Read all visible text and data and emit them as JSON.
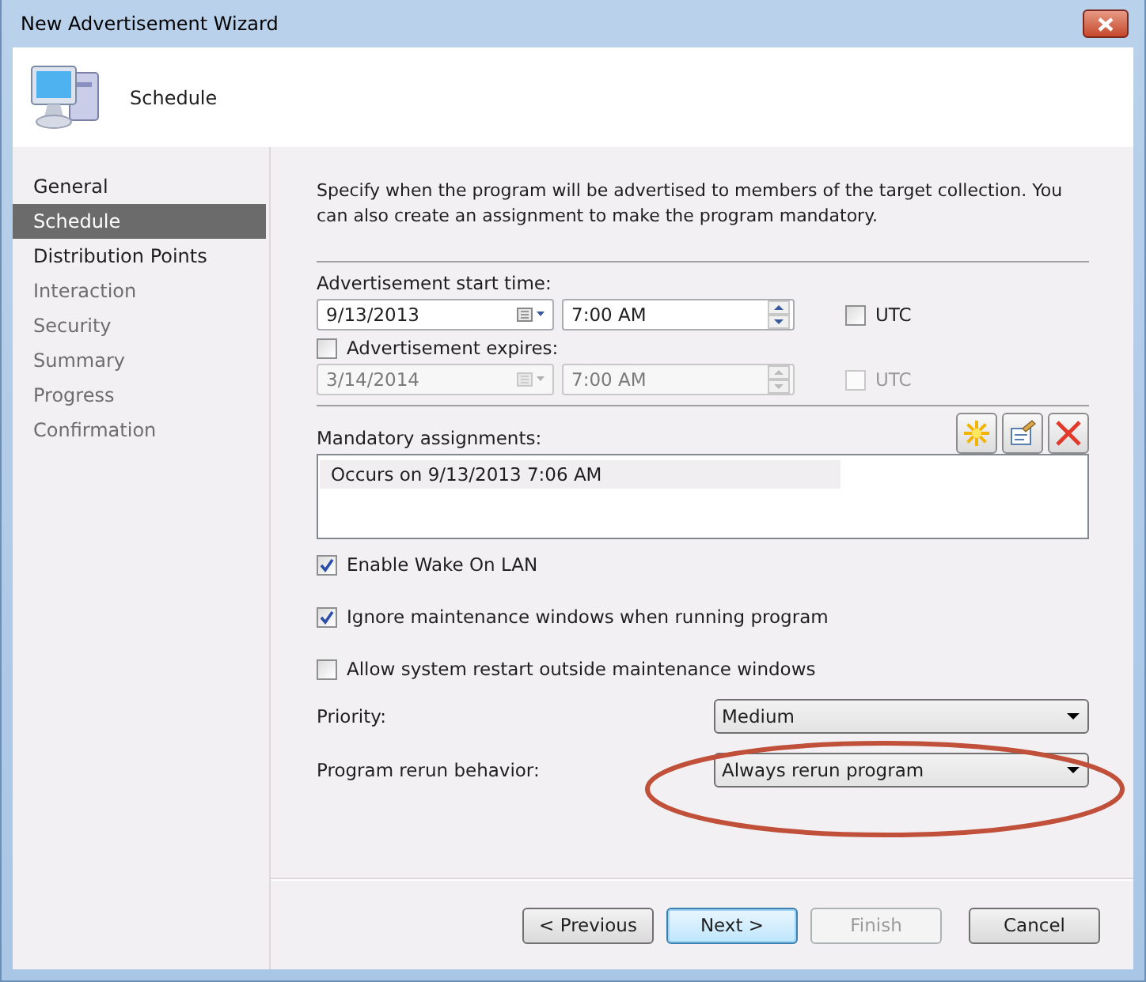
{
  "window": {
    "title": "New Advertisement Wizard"
  },
  "header": {
    "title": "Schedule"
  },
  "steps": [
    {
      "label": "General",
      "selected": false,
      "disabled": false
    },
    {
      "label": "Schedule",
      "selected": true,
      "disabled": false
    },
    {
      "label": "Distribution Points",
      "selected": false,
      "disabled": false
    },
    {
      "label": "Interaction",
      "selected": false,
      "disabled": true
    },
    {
      "label": "Security",
      "selected": false,
      "disabled": true
    },
    {
      "label": "Summary",
      "selected": false,
      "disabled": true
    },
    {
      "label": "Progress",
      "selected": false,
      "disabled": true
    },
    {
      "label": "Confirmation",
      "selected": false,
      "disabled": true
    }
  ],
  "description": "Specify when the program will be advertised to members of the target collection. You can also create an assignment to make the program mandatory.",
  "start": {
    "label": "Advertisement start time:",
    "date": "9/13/2013",
    "time": "7:00 AM",
    "utc_label": "UTC",
    "utc_checked": false,
    "disabled": false
  },
  "expires": {
    "label": "Advertisement expires:",
    "checked": false,
    "date": "3/14/2014",
    "time": "7:00 AM",
    "utc_label": "UTC",
    "utc_checked": false,
    "disabled": true
  },
  "assignments": {
    "label": "Mandatory assignments:",
    "items": [
      "Occurs on 9/13/2013 7:06 AM"
    ]
  },
  "options": [
    {
      "label": "Enable Wake On LAN",
      "checked": true
    },
    {
      "label": "Ignore maintenance windows when running program",
      "checked": true
    },
    {
      "label": "Allow system restart outside maintenance windows",
      "checked": false
    }
  ],
  "selects": [
    {
      "label": "Priority:",
      "value": "Medium",
      "highlighted": false
    },
    {
      "label": "Program rerun behavior:",
      "value": "Always rerun program",
      "highlighted": true
    }
  ],
  "buttons": [
    {
      "label": "< Previous",
      "disabled": false,
      "default": false
    },
    {
      "label": "Next >",
      "disabled": false,
      "default": true
    },
    {
      "label": "Finish",
      "disabled": true,
      "default": false
    },
    {
      "label": "Cancel",
      "disabled": false,
      "default": false
    }
  ]
}
